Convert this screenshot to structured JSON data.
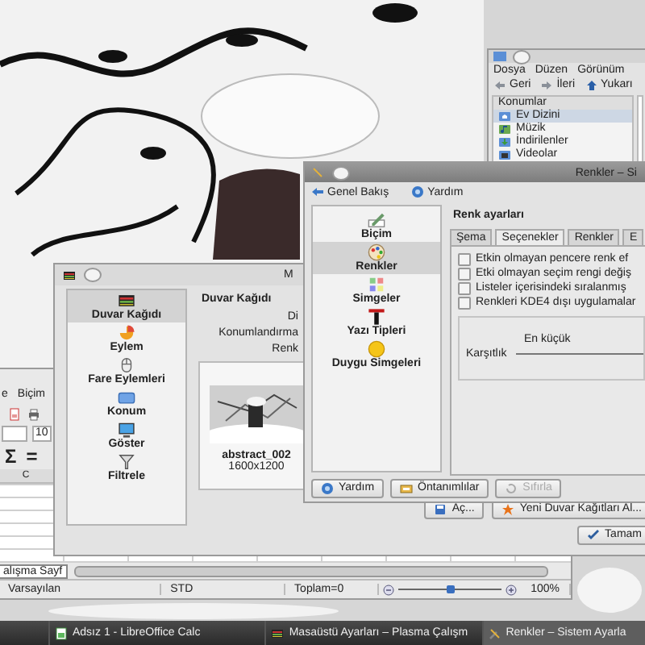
{
  "file_manager": {
    "menu": [
      "Dosya",
      "Düzen",
      "Görünüm"
    ],
    "toolbar": [
      "Geri",
      "İleri",
      "Yukarı"
    ],
    "panel_title": "Konumlar",
    "places": [
      {
        "label": "Ev Dizini",
        "selected": true
      },
      {
        "label": "Müzik",
        "selected": false
      },
      {
        "label": "İndirilenler",
        "selected": false
      },
      {
        "label": "Videolar",
        "selected": false
      }
    ]
  },
  "spreadsheet": {
    "menu": [
      "e",
      "Biçim"
    ],
    "font_size": "10",
    "formula_symbols": [
      "Σ",
      "="
    ],
    "column": "C",
    "sheet_tab": "alışma Sayf",
    "status": [
      "Varsayılan",
      "STD",
      "Toplam=0"
    ],
    "zoom": {
      "level": 0.5,
      "reading": "100%"
    }
  },
  "desktop_settings": {
    "title": "M",
    "sidebar": [
      {
        "label": "Duvar Kağıdı",
        "selected": true
      },
      {
        "label": "Eylem",
        "selected": false
      },
      {
        "label": "Fare Eylemleri",
        "selected": false
      },
      {
        "label": "Konum",
        "selected": false
      },
      {
        "label": "Göster",
        "selected": false
      },
      {
        "label": "Filtrele",
        "selected": false
      }
    ],
    "heading": "Duvar Kağıdı",
    "fields": [
      "Di",
      "Konumlandırma",
      "Renk"
    ],
    "wallpaper": {
      "name": "abstract_002",
      "size": "1600x1200"
    },
    "buttons": [
      "Aç...",
      "Yeni Duvar Kağıtları Al..."
    ],
    "ok_button": "Tamam"
  },
  "system_settings": {
    "title": "Renkler – Si",
    "toolbar": [
      "Genel Bakış",
      "Yardım"
    ],
    "sidebar": [
      {
        "label": "Biçim",
        "selected": false
      },
      {
        "label": "Renkler",
        "selected": true
      },
      {
        "label": "Simgeler",
        "selected": false
      },
      {
        "label": "Yazı Tipleri",
        "selected": false
      },
      {
        "label": "Duygu Simgeleri",
        "selected": false
      }
    ],
    "heading": "Renk ayarları",
    "tabs": [
      {
        "label": "Şema",
        "selected": false
      },
      {
        "label": "Seçenekler",
        "selected": true
      },
      {
        "label": "Renkler",
        "selected": false
      },
      {
        "label": "E",
        "selected": false
      }
    ],
    "options": [
      {
        "label": "Etkin olmayan pencere renk ef",
        "checked": false
      },
      {
        "label": "Etki olmayan seçim rengi değiş",
        "checked": false
      },
      {
        "label": "Listeler içerisindeki sıralanmış",
        "checked": false
      },
      {
        "label": "Renkleri KDE4 dışı uygulamalar",
        "checked": false
      }
    ],
    "contrast": {
      "label": "Karşıtlık",
      "min_label": "En küçük"
    },
    "buttons": [
      {
        "label": "Yardım",
        "disabled": false
      },
      {
        "label": "Öntanımlılar",
        "disabled": false
      },
      {
        "label": "Sıfırla",
        "disabled": true
      }
    ]
  },
  "taskbar": [
    {
      "label": "Adsız 1 - LibreOffice Calc",
      "selected": false
    },
    {
      "label": "Masaüstü Ayarları – Plasma Çalışm",
      "selected": false
    },
    {
      "label": "Renkler – Sistem Ayarla",
      "selected": true
    }
  ]
}
